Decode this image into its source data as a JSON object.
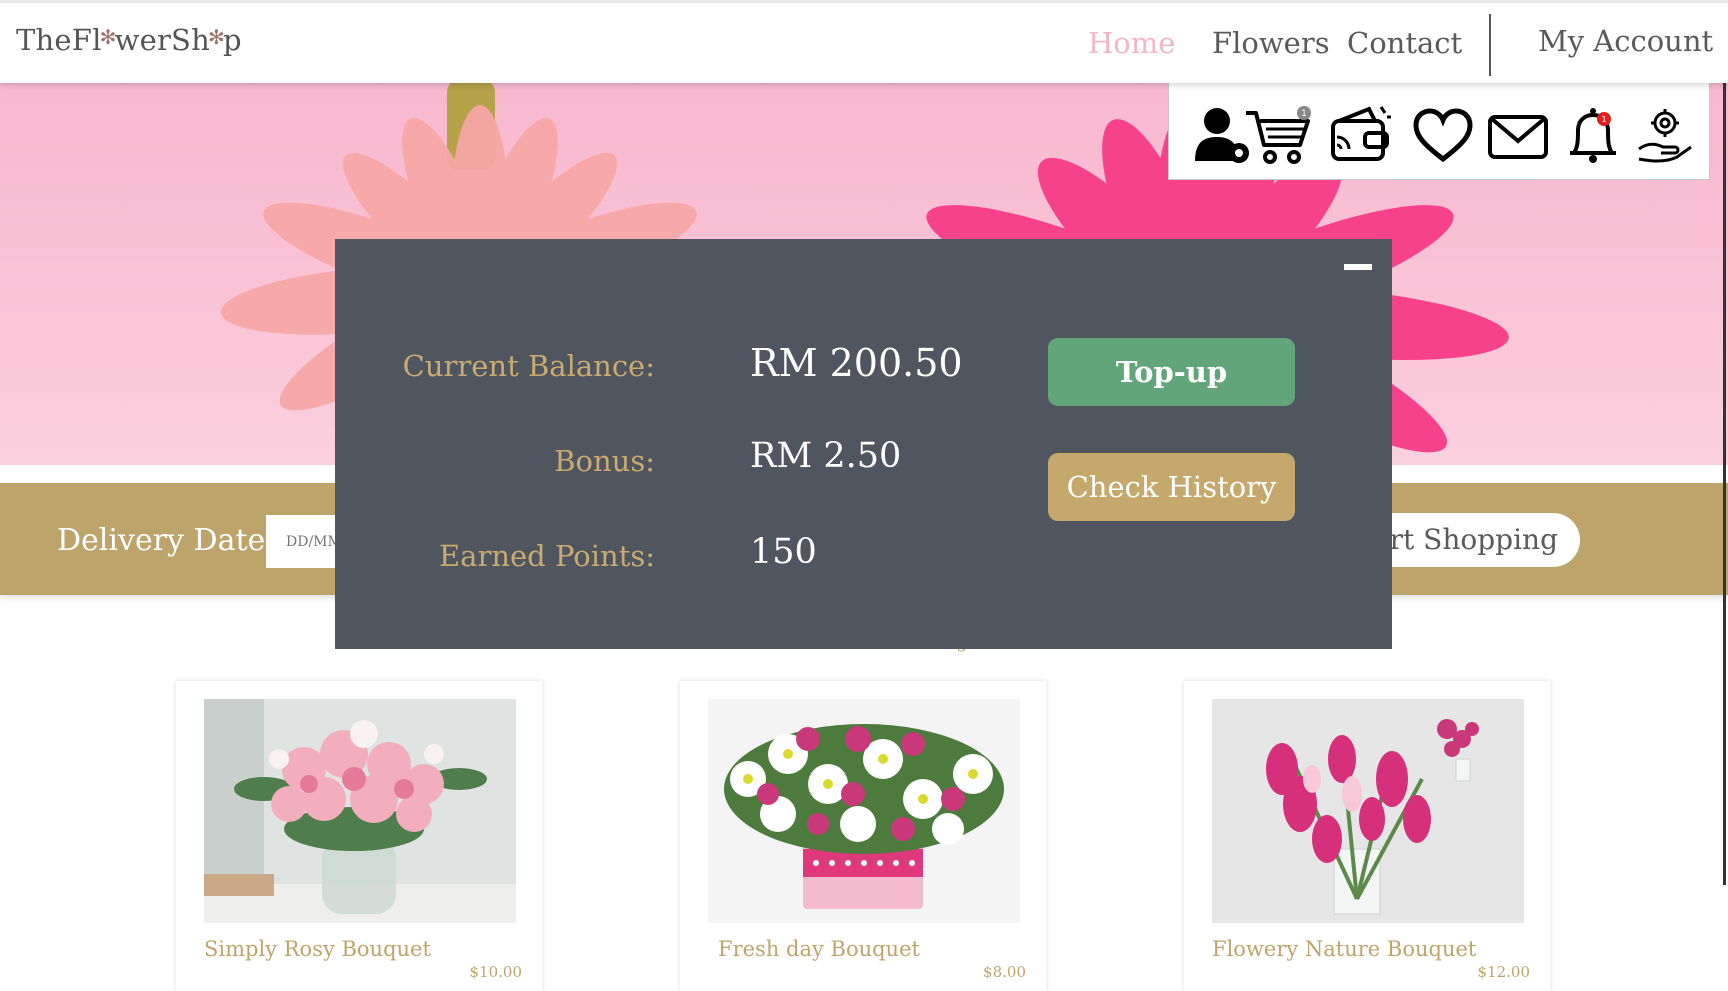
{
  "brand": {
    "logo_pre": "TheFl",
    "logo_o1": "✻",
    "logo_mid": "werSh",
    "logo_o2": "✻",
    "logo_post": "p"
  },
  "nav": {
    "home": "Home",
    "flowers": "Flowers",
    "contact": "Contact",
    "account": "My Account"
  },
  "icons": {
    "profile": "user-settings-icon",
    "cart": "cart-icon",
    "cart_badge": "1",
    "wallet": "wallet-icon",
    "wishlist": "heart-icon",
    "messages": "envelope-icon",
    "notifications": "bell-icon",
    "notifications_badge": "1",
    "support": "hand-gear-icon"
  },
  "delivery": {
    "label": "Delivery Date:",
    "placeholder": "DD/MM/YYYY",
    "shop_button": "Start Shopping"
  },
  "best_selling_title": "The Week's Best Selling",
  "products": [
    {
      "name": "Simply Rosy Bouquet",
      "price": "$10.00"
    },
    {
      "name": "Fresh day Bouquet",
      "price": "$8.00"
    },
    {
      "name": "Flowery Nature Bouquet",
      "price": "$12.00"
    }
  ],
  "wallet_modal": {
    "balance_label": "Current Balance:",
    "balance_value": "RM 200.50",
    "bonus_label": "Bonus:",
    "bonus_value": "RM 2.50",
    "points_label": "Earned Points:",
    "points_value": "150",
    "topup_button": "Top-up",
    "history_button": "Check History"
  },
  "colors": {
    "gold": "#bda46b",
    "modal_bg": "#505660",
    "topup": "#62a57b",
    "history": "#c5a86b",
    "nav_active": "#f4b6c6",
    "badge_red": "#e02020"
  }
}
